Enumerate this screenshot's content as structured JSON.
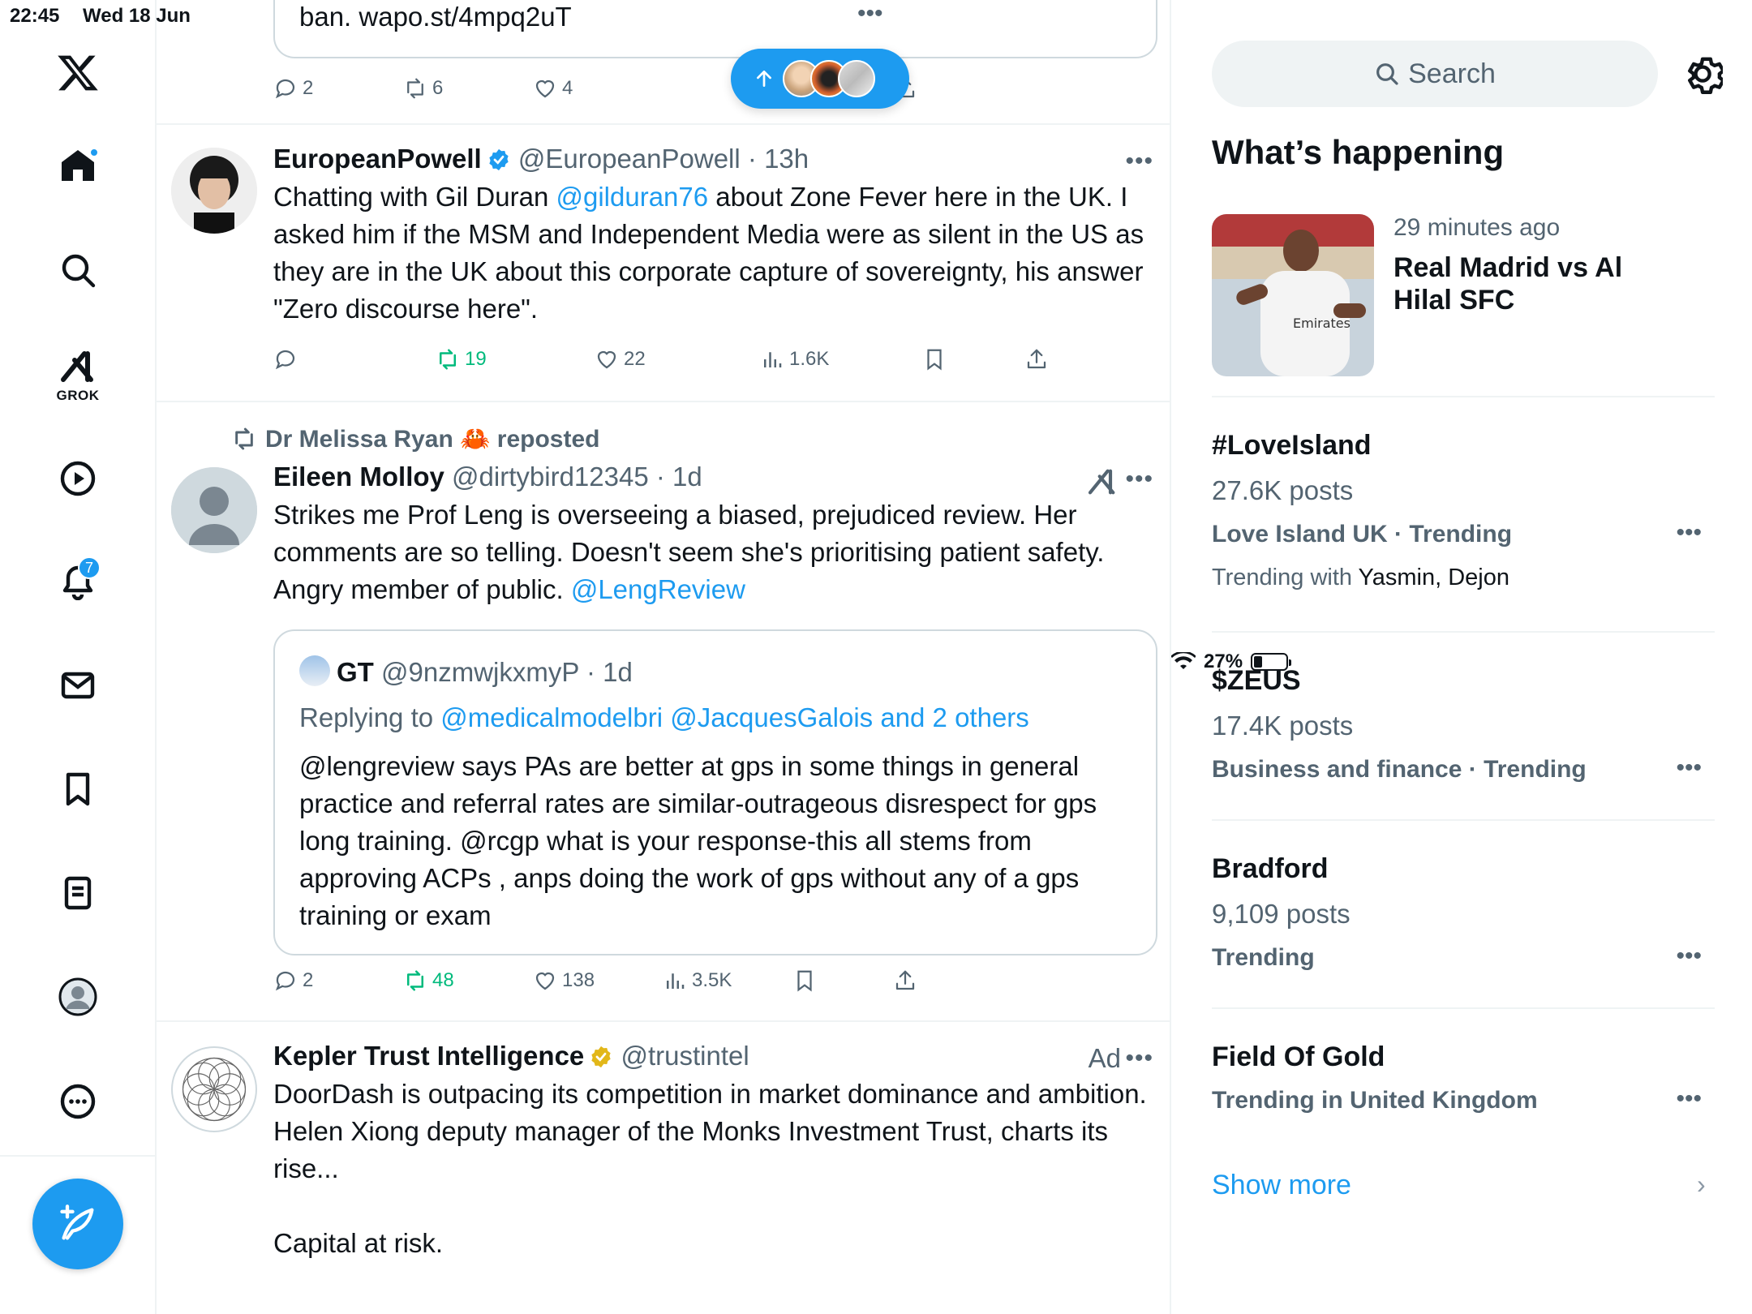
{
  "status_bar": {
    "time": "22:45",
    "date": "Wed 18 Jun",
    "battery": "27%",
    "battery_level": 0.27
  },
  "nav": {
    "grok_label": "GROK",
    "notifications_badge": "7"
  },
  "toast": {
    "label": "new posts"
  },
  "feed": {
    "top_partial": {
      "link_text": "ban. wapo.st/4mpq2uT",
      "replies": "2",
      "reposts": "6",
      "likes": "4"
    },
    "tweet1": {
      "name": "EuropeanPowell",
      "handle": "@EuropeanPowell",
      "time": "· 13h",
      "text_a": "Chatting with Gil Duran ",
      "mention": "@gilduran76",
      "text_b": "  about Zone Fever here in the UK. I asked him if the MSM and Independent Media were as silent in the US as they are in the UK about this corporate capture of sovereignty, his answer \"Zero discourse here\".",
      "replies": "",
      "reposts": "19",
      "likes": "22",
      "views": "1.6K"
    },
    "tweet2": {
      "repost_line": "Dr Melissa Ryan 🦀 reposted",
      "name": "Eileen Molloy",
      "handle": "@dirtybird12345",
      "time": "· 1d",
      "text": "Strikes me Prof Leng is overseeing a biased, prejudiced review. Her comments are so telling. Doesn't seem she's prioritising patient safety. Angry member of public. ",
      "mention": "@LengReview",
      "quote": {
        "name": "GT",
        "handle": "@9nzmwjkxmyP",
        "time": "· 1d",
        "replying_prefix": "Replying to ",
        "replying_to": "@medicalmodelbri @JacquesGalois and 2 others",
        "text": "@lengreview  says PAs are better at gps in some things in general practice and referral rates are similar-outrageous disrespect for gps long training. @rcgp what is your response-this all stems from approving ACPs , anps doing the work of gps without any of a gps training or exam"
      },
      "replies": "2",
      "reposts": "48",
      "likes": "138",
      "views": "3.5K"
    },
    "tweet3": {
      "name": "Kepler Trust Intelligence",
      "handle": "@trustintel",
      "ad_label": "Ad",
      "text": "DoorDash is outpacing its competition in market dominance and ambition. Helen Xiong deputy manager of the Monks Investment Trust, charts its rise...",
      "text2": "Capital at risk."
    }
  },
  "right": {
    "search_placeholder": "Search",
    "section_title": "What’s happening",
    "featured": {
      "time": "29 minutes ago",
      "title": "Real Madrid vs Al Hilal SFC"
    },
    "trends": [
      {
        "name": "#LoveIsland",
        "posts": "27.6K posts",
        "context": "Love Island UK · Trending",
        "with_prefix": "Trending with ",
        "with_names": "Yasmin, Dejon"
      },
      {
        "name": "$ZEUS",
        "posts": "17.4K posts",
        "context": "Business and finance · Trending"
      },
      {
        "name": "Bradford",
        "posts": "9,109 posts",
        "context": "Trending"
      },
      {
        "name": "Field Of Gold",
        "context": "Trending in United Kingdom"
      }
    ],
    "show_more": "Show more"
  },
  "colors": {
    "accent": "#1d9bf0",
    "repost_green": "#00ba7c",
    "muted": "#536471",
    "border": "#eff3f4"
  }
}
